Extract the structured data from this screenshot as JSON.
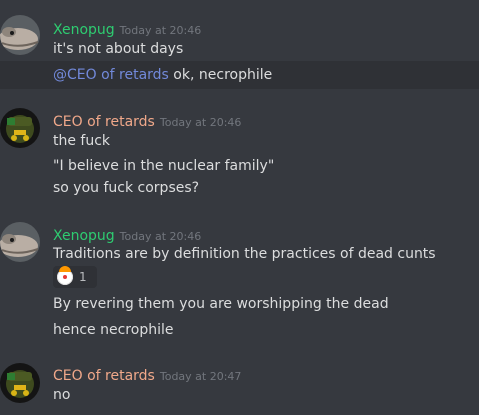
{
  "colors": {
    "background": "#36393f",
    "xenopug": "#2ecc71",
    "ceo": "#f0a88a",
    "mention": "#7289da",
    "timestamp": "#72767d"
  },
  "messages": [
    {
      "author": "Xenopug",
      "timestamp": "Today at 20:46",
      "lines": [
        "it's not about days"
      ],
      "highlighted_line": {
        "mention": "@CEO of retards",
        "text": " ok, necrophile"
      }
    },
    {
      "author": "CEO of retards",
      "timestamp": "Today at 20:46",
      "lines": [
        "the fuck",
        "\"I believe in the nuclear family\"",
        "so you fuck corpses?"
      ]
    },
    {
      "author": "Xenopug",
      "timestamp": "Today at 20:46",
      "lines": [
        "Traditions are by definition the practices of dead cunts"
      ],
      "reaction": {
        "emoji": "clown-icon",
        "count": "1"
      },
      "lines_after": [
        "By revering them you are worshipping the dead",
        "hence necrophile"
      ]
    },
    {
      "author": "CEO of retards",
      "timestamp": "Today at 20:47",
      "lines": [
        "no"
      ]
    }
  ]
}
